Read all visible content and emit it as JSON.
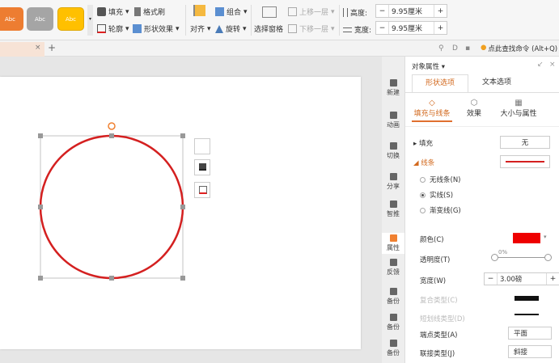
{
  "ribbon": {
    "styles": [
      {
        "label": "Abc",
        "color": "#ed7d31"
      },
      {
        "label": "Abc",
        "color": "#a5a5a5"
      },
      {
        "label": "Abc",
        "color": "#ffc000"
      }
    ],
    "fill": "填充",
    "format_painter": "格式刷",
    "outline": "轮廓",
    "shape_effects": "形状效果",
    "align": "对齐",
    "group": "组合",
    "rotate": "旋转",
    "selection_pane": "选择窗格",
    "bring_forward": "上移一层",
    "send_backward": "下移一层",
    "height_label": "高度:",
    "height_value": "9.95厘米",
    "width_label": "宽度:",
    "width_value": "9.95厘米",
    "minus": "−",
    "plus": "+"
  },
  "tabbar": {
    "close": "×",
    "new_tab": "+",
    "search_command": "点此查找命令 (Alt+Q)"
  },
  "sidebar": [
    "新建",
    "动画",
    "切换",
    "分享",
    "智推",
    "属性",
    "反馈",
    "备份",
    "备份",
    "备份"
  ],
  "panel": {
    "title": "对象属性",
    "tabs": [
      "形状选项",
      "文本选项"
    ],
    "subtabs": [
      "填充与线条",
      "效果",
      "大小与属性"
    ],
    "fill_label": "填充",
    "fill_value": "无",
    "line_label": "线条",
    "line_options": [
      "无线条(N)",
      "实线(S)",
      "渐变线(G)"
    ],
    "color_label": "颜色(C)",
    "color_value": "#ee0000",
    "transparency_label": "透明度(T)",
    "transparency_value": "0%",
    "width_label": "宽度(W)",
    "width_value": "3.00磅",
    "compound_label": "复合类型(C)",
    "dash_label": "短划线类型(D)",
    "cap_label": "端点类型(A)",
    "cap_value": "平面",
    "join_label": "联接类型(J)",
    "join_value": "斜接"
  },
  "shape": {
    "stroke": "#d42020"
  }
}
